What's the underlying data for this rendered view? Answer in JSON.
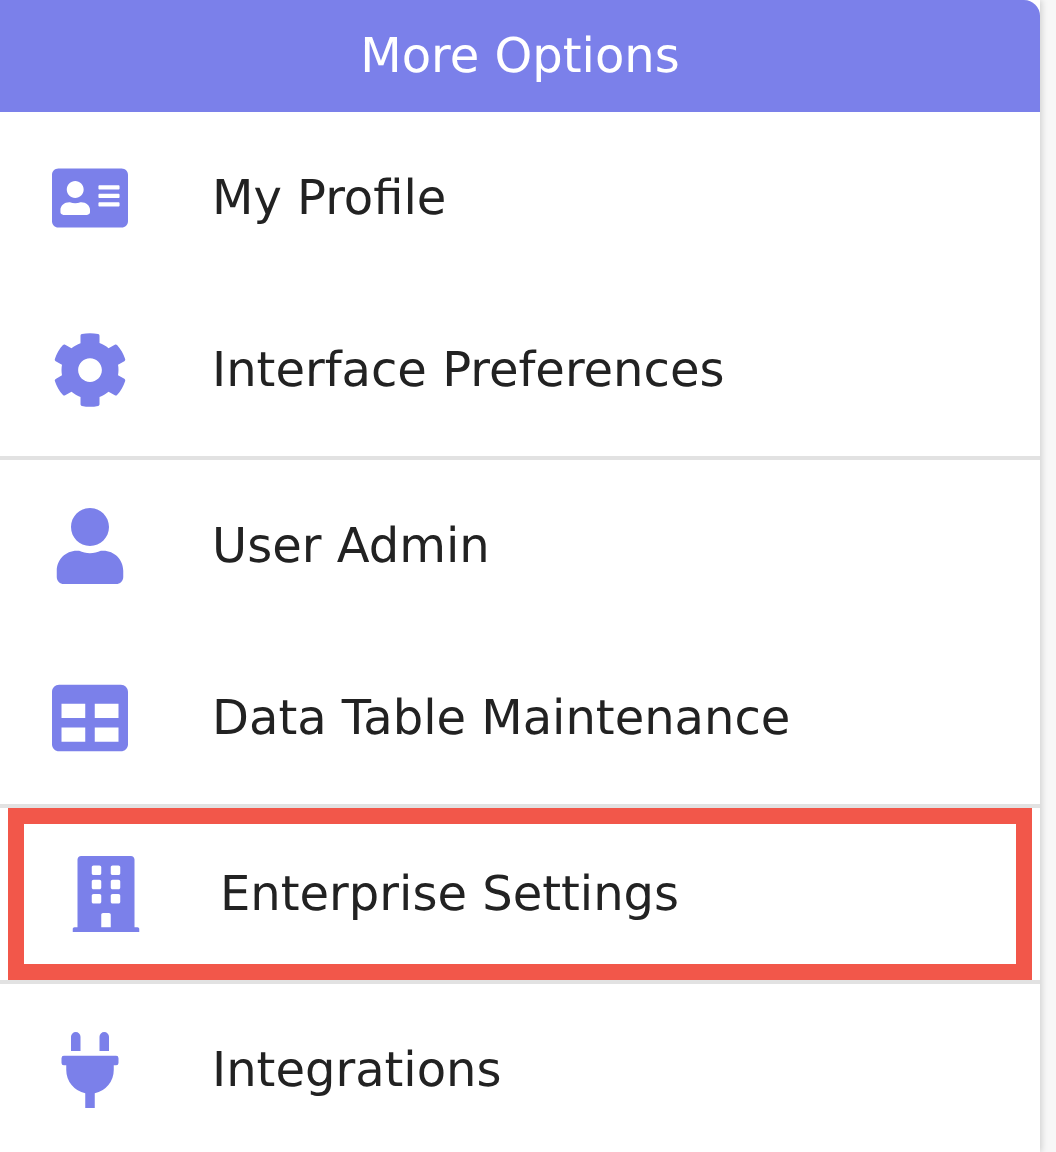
{
  "menu": {
    "title": "More Options",
    "sections": [
      {
        "items": [
          {
            "label": "My Profile",
            "highlighted": false
          },
          {
            "label": "Interface Preferences",
            "highlighted": false
          }
        ]
      },
      {
        "items": [
          {
            "label": "User Admin",
            "highlighted": false
          },
          {
            "label": "Data Table Maintenance",
            "highlighted": false
          }
        ]
      },
      {
        "items": [
          {
            "label": "Enterprise Settings",
            "highlighted": true
          }
        ]
      },
      {
        "items": [
          {
            "label": "Integrations",
            "highlighted": false
          }
        ]
      }
    ]
  }
}
